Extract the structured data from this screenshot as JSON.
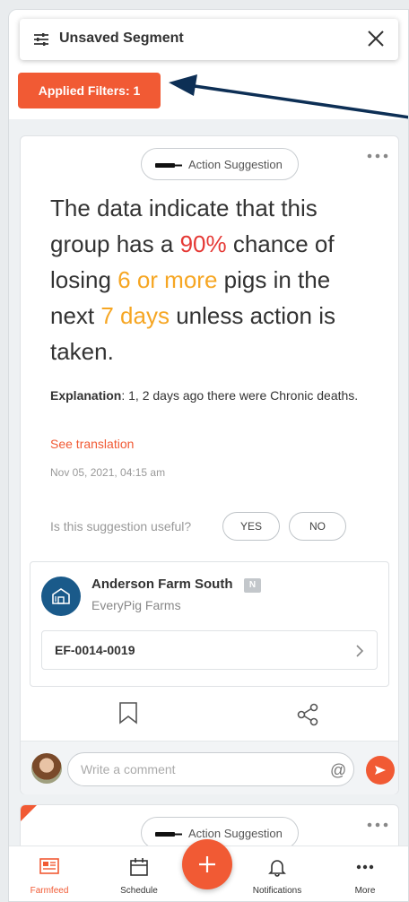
{
  "segment": {
    "title": "Unsaved Segment",
    "filters_label": "Applied Filters: 1"
  },
  "card": {
    "type_label": "Action Suggestion",
    "headline": {
      "part1": "The data indicate that this group has a ",
      "probability": "90%",
      "part2": " chance of losing ",
      "count": "6 or more",
      "part3": " pigs in the next ",
      "window": "7 days",
      "part4": " unless action is taken."
    },
    "explanation_label": "Explanation",
    "explanation_text": ": 1, 2 days ago there were Chronic deaths.",
    "see_translation": "See translation",
    "timestamp": "Nov 05, 2021, 04:15 am",
    "useful_question": "Is this suggestion useful?",
    "yes_label": "YES",
    "no_label": "NO",
    "farm": {
      "name": "Anderson Farm South",
      "tag": "N",
      "org": "EveryPig Farms",
      "group_id": "EF-0014-0019"
    },
    "comment_placeholder": "Write a comment",
    "at_symbol": "@"
  },
  "card2": {
    "type_label": "Action Suggestion"
  },
  "nav": {
    "items": [
      {
        "label": "Farmfeed",
        "active": true
      },
      {
        "label": "Schedule",
        "active": false
      },
      {
        "label": "Notifications",
        "active": false
      },
      {
        "label": "More",
        "active": false
      }
    ]
  },
  "colors": {
    "accent": "#f15a34",
    "probability": "#e53935",
    "highlight": "#f6a623",
    "farm_avatar": "#1a5a8a",
    "annotation_arrow": "#0d2f55"
  }
}
